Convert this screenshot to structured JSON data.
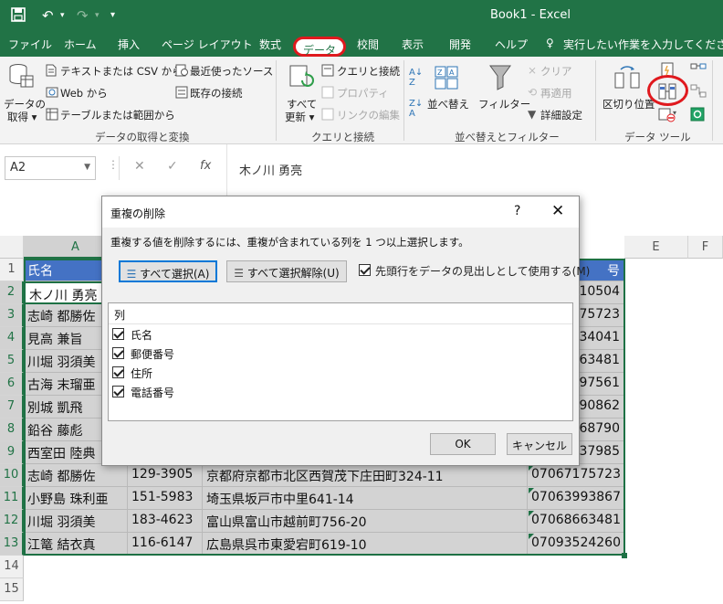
{
  "app": {
    "title": "Book1  -  Excel"
  },
  "tabs": [
    "ファイル",
    "ホーム",
    "挿入",
    "ページ レイアウト",
    "数式",
    "データ",
    "校閲",
    "表示",
    "開発",
    "ヘルプ",
    "実行したい作業を入力してください"
  ],
  "ribbon": {
    "get_data": {
      "label1": "データの",
      "label2": "取得 ▾"
    },
    "text_csv": "テキストまたは CSV から",
    "web": "Web から",
    "table_range": "テーブルまたは範囲から",
    "recent_sources": "最近使ったソース",
    "existing_conn": "既存の接続",
    "group_get": "データの取得と変換",
    "refresh_all1": "すべて",
    "refresh_all2": "更新 ▾",
    "queries_conn": "クエリと接続",
    "properties": "プロパティ",
    "edit_links": "リンクの編集",
    "group_queries": "クエリと接続",
    "sort": "並べ替え",
    "filter": "フィルター",
    "clear": "クリア",
    "reapply": "再適用",
    "advanced": "詳細設定",
    "group_sort": "並べ替えとフィルター",
    "text_to_columns": "区切り位置",
    "group_tools": "データ ツール"
  },
  "formula_bar": {
    "name_box": "A2",
    "value": "木ノ川 勇亮"
  },
  "columns": [
    "A",
    "E",
    "F"
  ],
  "rows": [
    {
      "n": "1",
      "a": "氏名",
      "b": "",
      "c": "",
      "d": "号"
    },
    {
      "n": "2",
      "a": "木ノ川 勇亮",
      "b": "",
      "c": "",
      "d": "10504"
    },
    {
      "n": "3",
      "a": "志崎 都勝佐",
      "b": "",
      "c": "",
      "d": "75723"
    },
    {
      "n": "4",
      "a": "見高 兼旨",
      "b": "",
      "c": "",
      "d": "34041"
    },
    {
      "n": "5",
      "a": "川堀 羽須美",
      "b": "",
      "c": "",
      "d": "63481"
    },
    {
      "n": "6",
      "a": "古海 末瑠亜",
      "b": "",
      "c": "",
      "d": "97561"
    },
    {
      "n": "7",
      "a": "別城 凱飛",
      "b": "",
      "c": "",
      "d": "90862"
    },
    {
      "n": "8",
      "a": "鉛谷 藤彪",
      "b": "",
      "c": "",
      "d": "68790"
    },
    {
      "n": "9",
      "a": "西室田 陸典",
      "b": "",
      "c": "",
      "d": "37985"
    },
    {
      "n": "10",
      "a": "志崎 都勝佐",
      "b": "129-3905",
      "c": "京都府京都市北区西賀茂下庄田町324-11",
      "d": "07067175723"
    },
    {
      "n": "11",
      "a": "小野島 珠利亜",
      "b": "151-5983",
      "c": "埼玉県坂戸市中里641-14",
      "d": "07063993867"
    },
    {
      "n": "12",
      "a": "川堀 羽須美",
      "b": "183-4623",
      "c": "富山県富山市越前町756-20",
      "d": "07068663481"
    },
    {
      "n": "13",
      "a": "江篭 結衣真",
      "b": "116-6147",
      "c": "広島県呉市東愛宕町619-10",
      "d": "07093524260"
    },
    {
      "n": "14",
      "a": "",
      "b": "",
      "c": "",
      "d": ""
    },
    {
      "n": "15",
      "a": "",
      "b": "",
      "c": "",
      "d": ""
    }
  ],
  "dialog": {
    "title": "重複の削除",
    "help": "?",
    "close": "✕",
    "instruction": "重複する値を削除するには、重複が含まれている列を 1 つ以上選択します。",
    "select_all": "すべて選択(A)",
    "unselect_all": "すべて選択解除(U)",
    "has_headers": "先頭行をデータの見出しとして使用する(M)",
    "list_header": "列",
    "columns": [
      "氏名",
      "郵便番号",
      "住所",
      "電話番号"
    ],
    "ok": "OK",
    "cancel": "キャンセル"
  }
}
